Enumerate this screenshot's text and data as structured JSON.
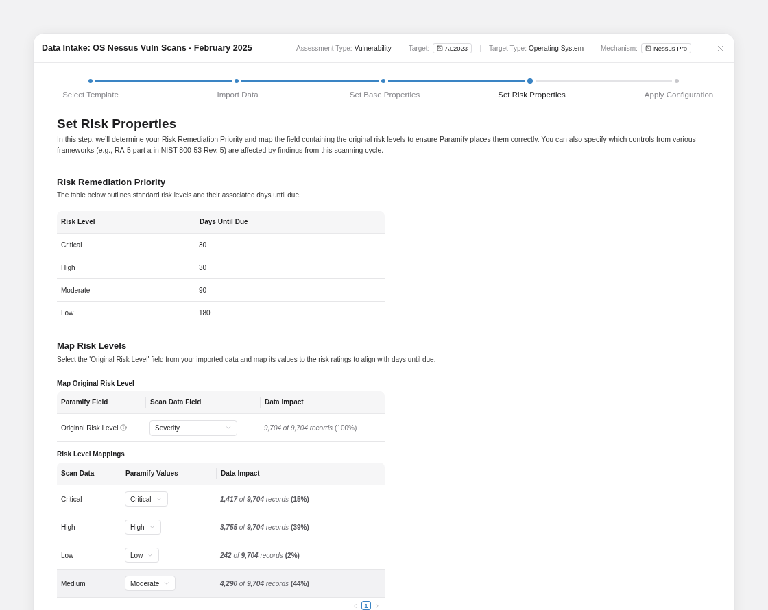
{
  "window": {
    "title": "Data Intake: OS Nessus Vuln Scans - February 2025",
    "meta": [
      {
        "kind": "text",
        "label": "Assessment Type:",
        "value": "Vulnerability"
      },
      {
        "kind": "chip",
        "label": "Target:",
        "value": "AL2023"
      },
      {
        "kind": "text",
        "label": "Target Type:",
        "value": "Operating System"
      },
      {
        "kind": "chip",
        "label": "Mechanism:",
        "value": "Nessus Pro"
      }
    ]
  },
  "steps": [
    {
      "label": "Select Template",
      "completed": true,
      "selected": false
    },
    {
      "label": "Import Data",
      "completed": true,
      "selected": false
    },
    {
      "label": "Set Base Properties",
      "completed": true,
      "selected": false
    },
    {
      "label": "Set Risk Properties",
      "completed": false,
      "selected": true
    },
    {
      "label": "Apply Configuration",
      "completed": false,
      "selected": false
    }
  ],
  "page": {
    "title": "Set Risk Properties",
    "intro": "In this step, we’ll determine your Risk Remediation Priority and map the field containing the original risk levels to ensure Paramify places them correctly. You can also specify which controls from various frameworks (e.g., RA-5 part a in NIST 800-53 Rev. 5) are affected by findings from this scanning cycle."
  },
  "priority": {
    "title": "Risk Remediation Priority",
    "description": "The table below outlines standard risk levels and their associated days until due.",
    "columns": [
      "Risk Level",
      "Days Until Due"
    ],
    "rows": [
      [
        "Critical",
        "30"
      ],
      [
        "High",
        "30"
      ],
      [
        "Moderate",
        "90"
      ],
      [
        "Low",
        "180"
      ]
    ]
  },
  "mapping": {
    "title": "Map Risk Levels",
    "description": "Select the 'Original Risk Level' field from your imported data and map its values to the risk ratings to align with days until due.",
    "field_table": {
      "title": "Map Original Risk Level",
      "columns": [
        "Paramify Field",
        "Scan Data Field",
        "Data Impact"
      ],
      "rows": [
        {
          "field": "Original Risk Level",
          "value": "Severity",
          "impact": "9,704 of 9,704 records",
          "share": "(100%)"
        }
      ]
    },
    "values_table": {
      "title": "Risk Level Mappings",
      "columns": [
        "Scan Data",
        "Paramify Values",
        "Data Impact"
      ],
      "rows": [
        {
          "scan": "Critical",
          "value": "Critical",
          "impact": "**1,417** of **9,704** records",
          "share": "(15%)",
          "highlighted": false
        },
        {
          "scan": "High",
          "value": "High",
          "impact": "**3,755** of **9,704** records",
          "share": "(39%)",
          "highlighted": false
        },
        {
          "scan": "Low",
          "value": "Low",
          "impact": "**242** of **9,704** records",
          "share": "(2%)",
          "highlighted": false
        },
        {
          "scan": "Medium",
          "value": "Moderate",
          "impact": "**4,290** of **9,704** records",
          "share": "(44%)",
          "highlighted": true
        }
      ]
    },
    "pagination": {
      "pages": [
        {
          "label": "1",
          "selected": true
        }
      ]
    }
  }
}
